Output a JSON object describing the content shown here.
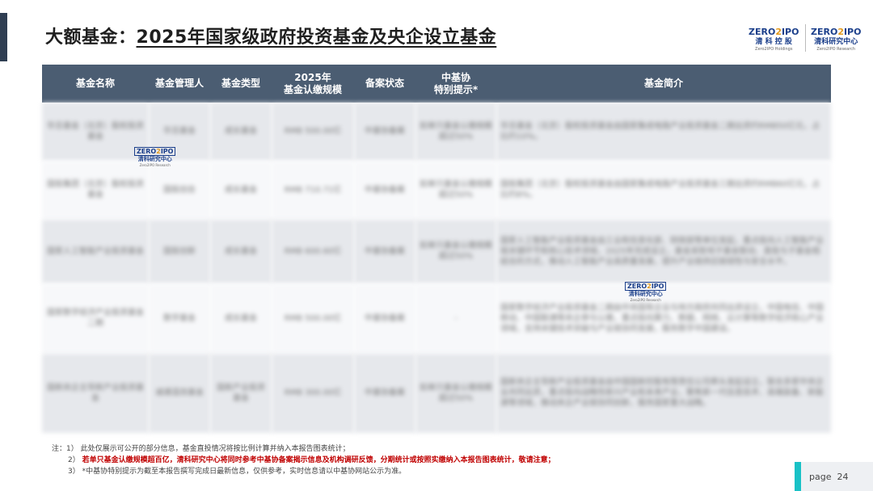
{
  "title": {
    "plain": "大额基金：",
    "underlined": "2025年国家级政府投资基金及央企设立基金"
  },
  "logos": {
    "left": {
      "brand_a": "ZERO",
      "brand_b": "2",
      "brand_c": "IPO",
      "sub": "清 科 控 股",
      "tiny": "Zero2IPO Holdings"
    },
    "right": {
      "brand_a": "ZERO",
      "brand_b": "2",
      "brand_c": "IPO",
      "sub": "清科研究中心",
      "tiny": "Zero2IPO Research"
    }
  },
  "watermark": {
    "brand_a": "ZERO",
    "brand_b": "2",
    "brand_c": "IPO",
    "sub": "清科研究中心",
    "tiny": "Zero2IPO Research"
  },
  "table": {
    "headers": [
      "基金名称",
      "基金管理人",
      "基金类型",
      "2025年\n基金认缴规模",
      "备案状态",
      "中基协\n特别提示*",
      "基金简介"
    ],
    "rows": [
      [
        "华旦基金（北京）股权投资基金",
        "华旦基金",
        "成长基金",
        "RMB 500.00亿",
        "中基协备案",
        "如单只基金认缴规模超过50%",
        "华旦基金（北京）股权投资基金由国家集成电路产业投资基金二期出资约RMB50亿元，占比约10%。"
      ],
      [
        "国投集团（北京）股权投资基金",
        "国投创合",
        "成长基金",
        "RMB 710.71亿",
        "中基协备案",
        "如单只基金认缴规模超过50%",
        "国投集团（北京）股权投资基金由国家集成电路产业投资基金三期出资约RMB60亿元，占比约8%。"
      ],
      [
        "国家人工智能产业投资基金",
        "国投创新",
        "成长基金",
        "RMB 600.60亿",
        "中基协备案",
        "如单只基金认缴规模超过50%",
        "国家人工智能产业投资基金由工业和信息化部、财政部等单位发起，重点投向人工智能产业链关键环节和核心技术领域，2025年完成设立，基金采取母子基金联动、直投与子基金相结合的方式，推动人工智能产业高质量发展，提升产业链供应链韧性与安全水平。"
      ],
      [
        "国家数字经济产业投资基金二期",
        "数字基金",
        "成长基金",
        "RMB 500.00亿",
        "中基协备案",
        "-",
        "国家数字经济产业投资基金二期由中央国有企业与地方政府共同出资设立，中国电信、中国移动、中国联通等央企参与认缴，重点投向算力、数据、网络、云计算等数字经济核心产业领域，支持关键技术突破与产业链协同发展，服务数字中国建设。"
      ],
      [
        "国新央企主导新产业投资基金",
        "诚通混改基金",
        "国新产业投资基金",
        "RMB 300.00亿",
        "中基协备案",
        "如单只基金认缴规模超过50%",
        "国新央企主导新产业投资基金由中国国新控股有限责任公司牵头发起设立，联合多家中央企业共同出资，重点投向战略性新兴产业和未来产业，聚焦新一代信息技术、高端装备、新能源等领域，推动央企产业链协同创新，服务国家重大战略。"
      ]
    ]
  },
  "notes": {
    "prefix": "注：",
    "n1_num": "1）",
    "n1": "此处仅展示可公开的部分信息，基金直投情况将按比例计算并纳入本报告图表统计；",
    "n2_num": "2）",
    "n2": "若单只基金认缴规模超百亿，清科研究中心将同时参考中基协备案揭示信息及机构调研反馈，分期统计或按照实缴纳入本报告图表统计，敬请注意；",
    "n3_num": "3）",
    "n3": "*中基协特别提示为截至本报告撰写完成日最新信息，仅供参考，实时信息请以中基协网站公示为准。"
  },
  "page": {
    "label": "page",
    "number": "24"
  },
  "colors": {
    "header_bg": "#4b5d72",
    "accent": "#19c1c6",
    "brand_blue": "#1b3f8b",
    "brand_orange": "#e39a1c",
    "note_red": "#c00000"
  }
}
